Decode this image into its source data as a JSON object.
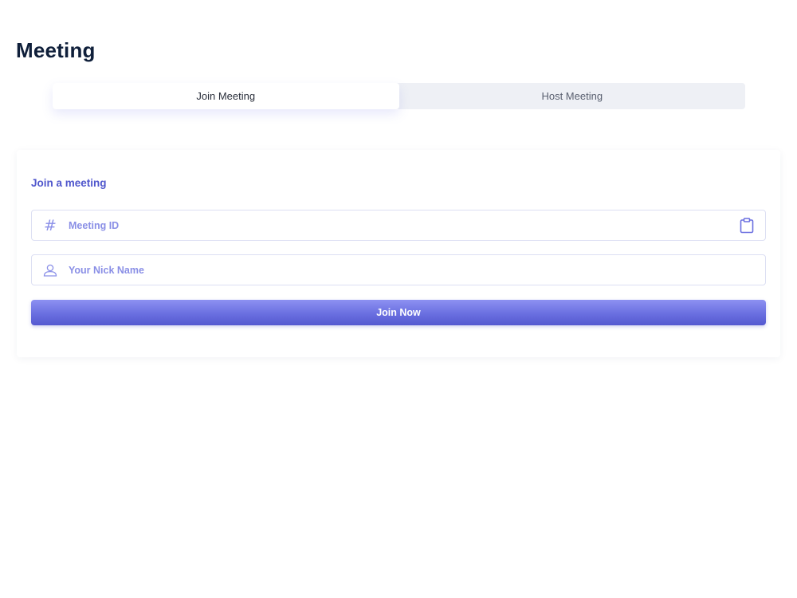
{
  "page": {
    "title": "Meeting"
  },
  "tabs": [
    {
      "label": "Join Meeting",
      "active": true
    },
    {
      "label": "Host Meeting",
      "active": false
    }
  ],
  "join_card": {
    "title": "Join a meeting",
    "meeting_id": {
      "placeholder": "Meeting ID",
      "value": "",
      "lead_icon": "hash-icon",
      "trail_icon": "clipboard-icon"
    },
    "nickname": {
      "placeholder": "Your Nick Name",
      "value": "",
      "lead_icon": "user-icon"
    },
    "submit_label": "Join Now"
  },
  "colors": {
    "title": "#0f1f3a",
    "accent": "#5f64dc",
    "accent_light": "#8b90e8",
    "tab_bg": "#eef0f5"
  }
}
